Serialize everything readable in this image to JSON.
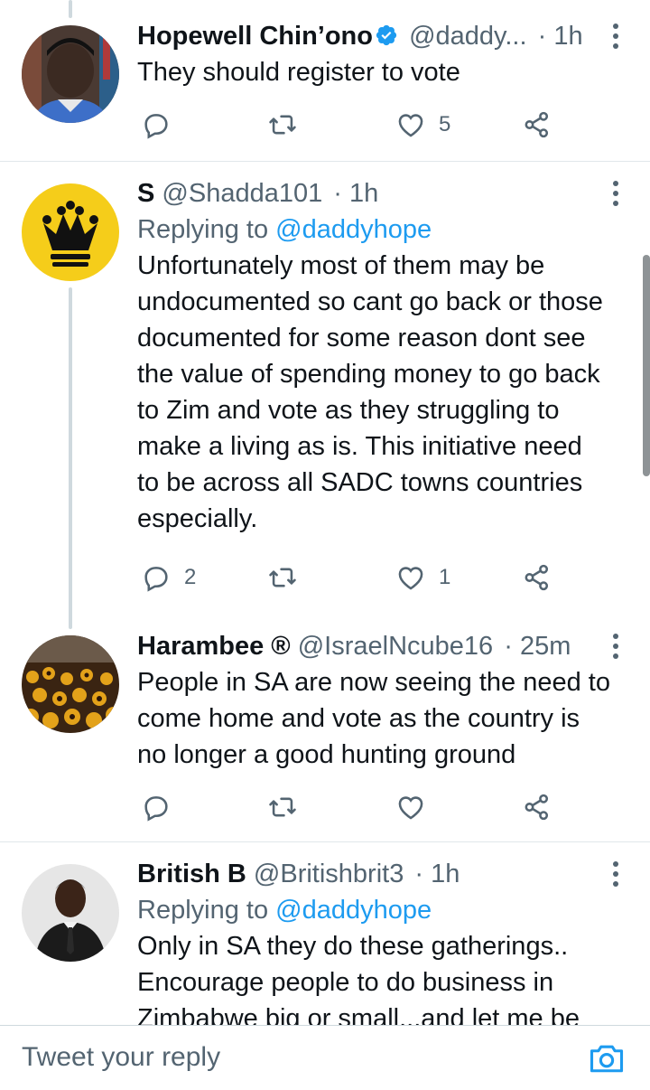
{
  "tweets": [
    {
      "name": "Hopewell Chin’ono",
      "handle": "@daddy...",
      "time": "· 1h",
      "verified": true,
      "text": "They should register to vote",
      "replies": "",
      "likes": "5"
    },
    {
      "name": "S",
      "handle": "@Shadda101",
      "time": "· 1h",
      "replying_label": "Replying to",
      "replying_handle": "@daddyhope",
      "text_lines": [
        "Unfortunately most of them may be",
        "undocumented so cant go back or those",
        "documented for some reason dont see",
        "the value of spending money to go back",
        "to Zim and vote as they struggling to",
        "make a living as is. This initiative need",
        "to be across all SADC towns countries",
        "especially."
      ],
      "replies": "2",
      "likes": "1"
    },
    {
      "name": "Harambee ®",
      "handle": "@IsraelNcube16",
      "time": "· 25m",
      "text_lines": [
        "People in SA are now seeing the need to",
        "come home and vote as the country is",
        "no longer a good hunting ground"
      ],
      "replies": "",
      "likes": ""
    },
    {
      "name": "British B",
      "handle": "@Britishbrit3",
      "time": "· 1h",
      "replying_label": "Replying to",
      "replying_handle": "@daddyhope",
      "text_lines": [
        "Only in SA  they do these gatherings..",
        "Encourage people to do business in",
        "Zimbabwe big or small...and let me be"
      ]
    }
  ],
  "composer": {
    "placeholder": "Tweet your reply"
  },
  "colors": {
    "accent": "#1d9bf0",
    "secondary_text": "#536471",
    "thread_line": "#cfd9de"
  },
  "icons": [
    "reply-icon",
    "retweet-icon",
    "like-icon",
    "share-icon",
    "more-icon",
    "verified-icon",
    "camera-icon"
  ]
}
